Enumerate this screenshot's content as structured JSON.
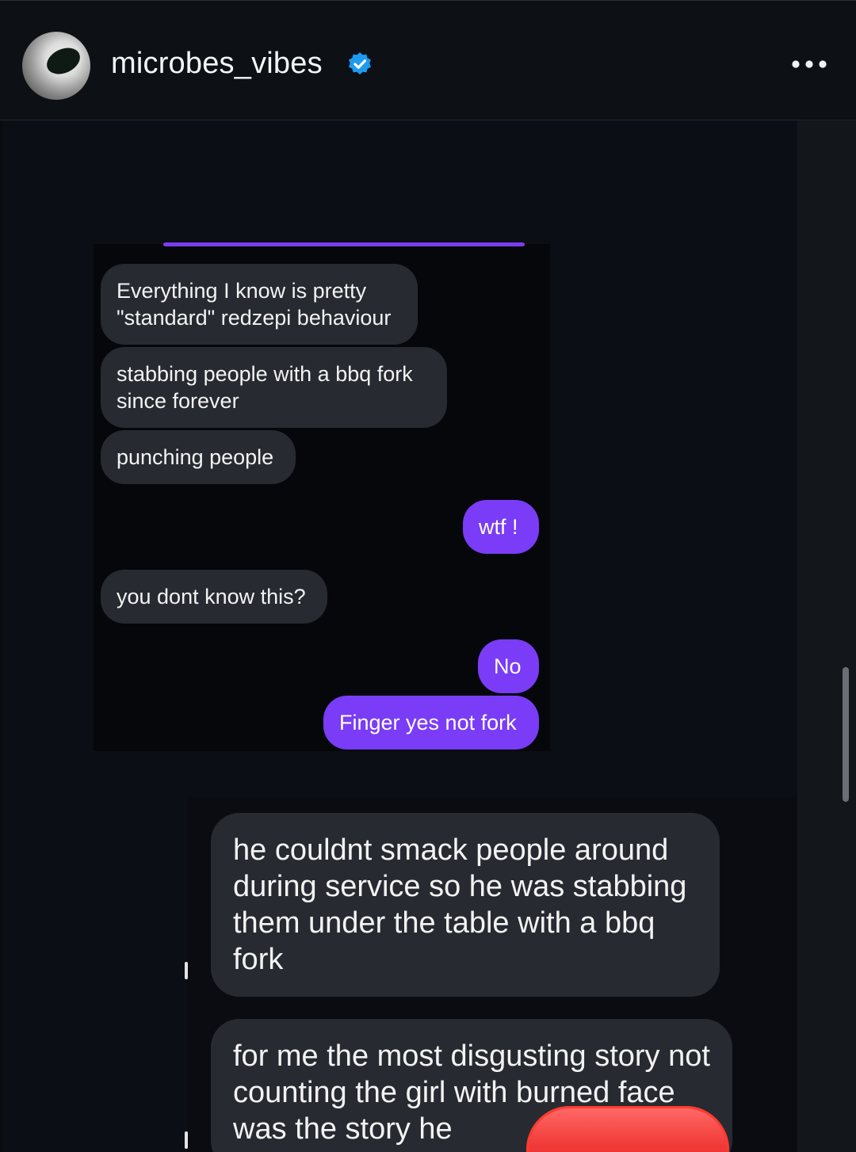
{
  "header": {
    "username": "microbes_vibes",
    "verified_icon": "verified-badge-icon",
    "more_icon": "more-options-icon",
    "accent_color": "#1d9bf0"
  },
  "chat1": {
    "messages": [
      {
        "side": "received",
        "text": "Everything I know is pretty \"standard\" redzepi behaviour"
      },
      {
        "side": "received",
        "text": "stabbing people with a bbq fork since forever"
      },
      {
        "side": "received",
        "text": "punching people"
      },
      {
        "side": "sent",
        "text": "wtf !"
      },
      {
        "side": "received",
        "text": "you dont know this?"
      },
      {
        "side": "sent",
        "text": "No"
      },
      {
        "side": "sent",
        "text": "Finger yes not fork"
      }
    ],
    "sent_color": "#7a3cf6",
    "received_color": "#272a31"
  },
  "chat2": {
    "messages": [
      {
        "side": "received",
        "text": "he couldnt smack people around during service so he was stabbing them under the table with a bbq fork"
      },
      {
        "side": "received",
        "text": "for me the most disgusting story not counting the girl with burned face was the story he"
      }
    ]
  }
}
